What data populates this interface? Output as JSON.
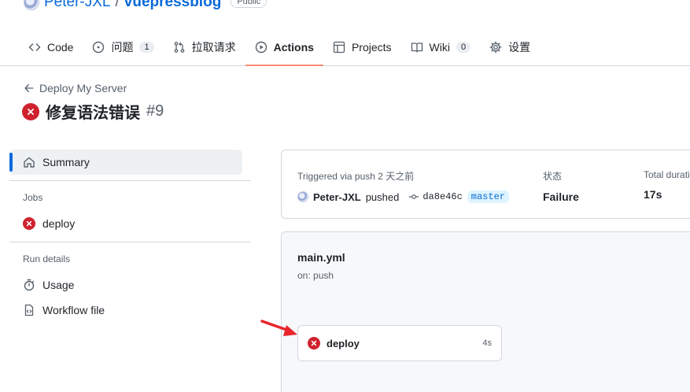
{
  "repo": {
    "owner": "Peter-JXL",
    "separator": "/",
    "name": "vuepressblog",
    "visibility": "Public"
  },
  "tabs": [
    {
      "label": "Code",
      "icon": "code-icon"
    },
    {
      "label": "问题",
      "icon": "issue-opened-icon",
      "count": "1"
    },
    {
      "label": "拉取请求",
      "icon": "git-pull-request-icon"
    },
    {
      "label": "Actions",
      "icon": "play-icon",
      "active": true
    },
    {
      "label": "Projects",
      "icon": "table-icon"
    },
    {
      "label": "Wiki",
      "icon": "book-icon",
      "count": "0"
    },
    {
      "label": "设置",
      "icon": "gear-icon"
    }
  ],
  "run": {
    "back_label": "Deploy My Server",
    "title": "修复语法错误",
    "number": "#9",
    "status_icon": "x-circle-fill-icon"
  },
  "sidebar": {
    "summary_label": "Summary",
    "jobs_heading": "Jobs",
    "jobs": [
      {
        "label": "deploy",
        "status_icon": "x-circle-fill-icon"
      }
    ],
    "run_details_heading": "Run details",
    "details": [
      {
        "label": "Usage",
        "icon": "stopwatch-icon"
      },
      {
        "label": "Workflow file",
        "icon": "file-code-icon"
      }
    ]
  },
  "summary": {
    "trigger_label": "Triggered via push 2 天之前",
    "actor": "Peter-JXL",
    "action": "pushed",
    "commit": "da8e46c",
    "branch": "master",
    "status_label": "状态",
    "status_value": "Failure",
    "duration_label": "Total duration",
    "duration_value": "17s"
  },
  "workflow": {
    "file": "main.yml",
    "trigger": "on: push",
    "job": {
      "name": "deploy",
      "duration": "4s"
    }
  },
  "colors": {
    "accent": "#0969da",
    "failure": "#cf222e",
    "tab_underline": "#fd8c73",
    "annotation_arrow": "#e8262b"
  }
}
